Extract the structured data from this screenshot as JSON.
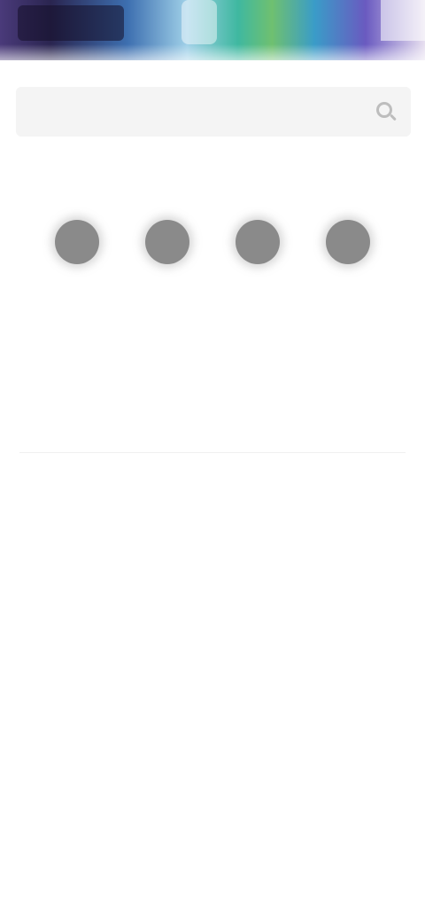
{
  "banner": {
    "colors": [
      "#4a3a7a",
      "#2a2550",
      "#3d6fb0",
      "#9fd0e8",
      "#3fb8a0",
      "#6fc070",
      "#3a9cc8",
      "#6a5ac0"
    ]
  },
  "search": {
    "placeholder": "",
    "icon": "search-icon"
  },
  "top_link": {
    "label": ""
  },
  "categories": [
    {
      "icon": "category-icon",
      "label": ""
    },
    {
      "icon": "category-icon",
      "label": ""
    },
    {
      "icon": "category-icon",
      "label": ""
    },
    {
      "icon": "category-icon",
      "label": ""
    }
  ],
  "headline": "",
  "subheadline": "",
  "article": {
    "text": "",
    "more_prefix": "",
    "more_link": ""
  },
  "colors": {
    "accent": "#f08080",
    "icon_gray": "#8a8a8a",
    "search_bg": "#f4f4f4"
  }
}
